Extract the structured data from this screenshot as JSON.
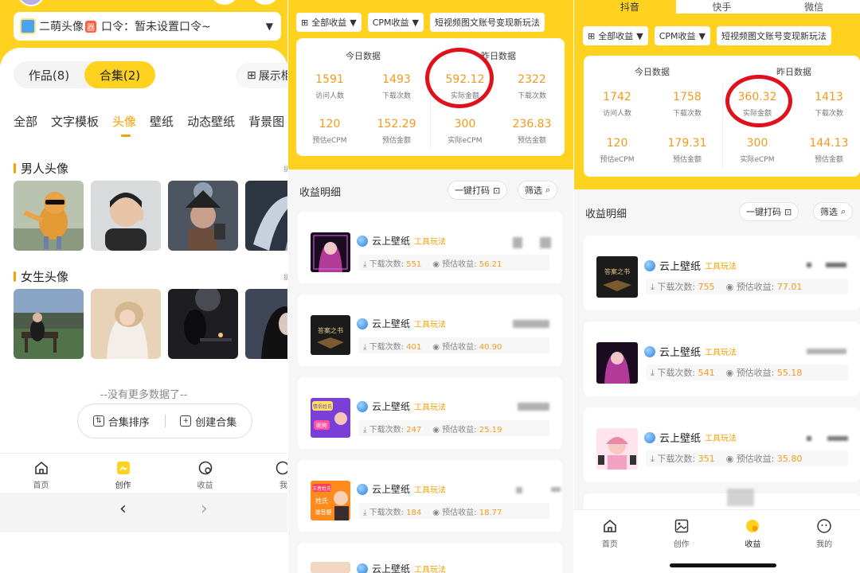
{
  "panel1": {
    "account": {
      "name": "二萌头像",
      "badge": "器",
      "command_label": "口令：暂未设置口令~"
    },
    "segments": [
      {
        "label": "作品(8)"
      },
      {
        "label": "合集(2)"
      }
    ],
    "show_button": "展示柜",
    "categories": [
      "全部",
      "文字模板",
      "头像",
      "壁纸",
      "动态壁纸",
      "背景图"
    ],
    "sections": [
      {
        "title": "男人头像",
        "more": "编"
      },
      {
        "title": "女生头像",
        "more": "编"
      }
    ],
    "no_more": "--没有更多数据了--",
    "collection_sort": "合集排序",
    "create_collection": "创建合集",
    "tabbar": [
      {
        "label": "首页"
      },
      {
        "label": "创作"
      },
      {
        "label": "收益"
      },
      {
        "label": "我"
      }
    ],
    "nav_back": "‹",
    "nav_forward": "›"
  },
  "panel2": {
    "filters": {
      "all_income": "全部收益",
      "cpm": "CPM收益",
      "promo": "短视频图文账号变现新玩法"
    },
    "today_label": "今日数据",
    "yesterday_label": "昨日数据",
    "stats": [
      {
        "value": "1591",
        "label": "访问人数"
      },
      {
        "value": "1493",
        "label": "下载次数"
      },
      {
        "value": "592.12",
        "label": "实际金额"
      },
      {
        "value": "2322",
        "label": "下载次数"
      },
      {
        "value": "120",
        "label": "预估eCPM"
      },
      {
        "value": "152.29",
        "label": "预估金额"
      },
      {
        "value": "300",
        "label": "实际eCPM"
      },
      {
        "value": "236.83",
        "label": "预估金额"
      }
    ],
    "detail_title": "收益明细",
    "one_click": "一键打码",
    "filter": "筛选",
    "items": [
      {
        "name": "云上壁纸",
        "tag": "工具玩法",
        "dl_label": "下载次数:",
        "downloads": "551",
        "est_label": "预估收益:",
        "est": "56.21"
      },
      {
        "name": "云上壁纸",
        "tag": "工具玩法",
        "dl_label": "下载次数:",
        "downloads": "401",
        "est_label": "预估收益:",
        "est": "40.90"
      },
      {
        "name": "云上壁纸",
        "tag": "工具玩法",
        "dl_label": "下载次数:",
        "downloads": "247",
        "est_label": "预估收益:",
        "est": "25.19"
      },
      {
        "name": "云上壁纸",
        "tag": "工具玩法",
        "dl_label": "下载次数:",
        "downloads": "184",
        "est_label": "预估收益:",
        "est": "18.77"
      },
      {
        "name": "云上壁纸",
        "tag": "工具玩法"
      }
    ],
    "thumb_text": {
      "book": "答案之书",
      "t3a": "情侣姓氏",
      "t3b": "昵称",
      "t4a": "王者姓氏",
      "t4b": "姓氏",
      "t4c": "谐音梗"
    }
  },
  "panel3": {
    "platform_tabs": [
      {
        "label": "抖音"
      },
      {
        "label": "快手"
      },
      {
        "label": "微信"
      }
    ],
    "filters": {
      "all_income": "全部收益",
      "cpm": "CPM收益",
      "promo": "短视频图文账号变现新玩法"
    },
    "today_label": "今日数据",
    "yesterday_label": "昨日数据",
    "stats": [
      {
        "value": "1742",
        "label": "访问人数"
      },
      {
        "value": "1758",
        "label": "下载次数"
      },
      {
        "value": "360.32",
        "label": "实际金额"
      },
      {
        "value": "1413",
        "label": "下载次数"
      },
      {
        "value": "120",
        "label": "预估eCPM"
      },
      {
        "value": "179.31",
        "label": "预估金额"
      },
      {
        "value": "300",
        "label": "实际eCPM"
      },
      {
        "value": "144.13",
        "label": "预估金额"
      }
    ],
    "detail_title": "收益明细",
    "one_click": "一键打码",
    "filter": "筛选",
    "items": [
      {
        "name": "云上壁纸",
        "tag": "工具玩法",
        "dl_label": "下载次数:",
        "downloads": "755",
        "est_label": "预估收益:",
        "est": "77.01"
      },
      {
        "name": "云上壁纸",
        "tag": "工具玩法",
        "dl_label": "下载次数:",
        "downloads": "541",
        "est_label": "预估收益:",
        "est": "55.18"
      },
      {
        "name": "云上壁纸",
        "tag": "工具玩法",
        "dl_label": "下载次数:",
        "downloads": "351",
        "est_label": "预估收益:",
        "est": "35.80"
      }
    ],
    "thumb_text": {
      "book": "答案之书"
    },
    "tabbar": [
      {
        "label": "首页"
      },
      {
        "label": "创作"
      },
      {
        "label": "收益"
      },
      {
        "label": "我的"
      }
    ]
  },
  "colors": {
    "brand_yellow": "#ffd21f",
    "accent_orange": "#f29a1f",
    "highlight_red": "#e0101c"
  }
}
